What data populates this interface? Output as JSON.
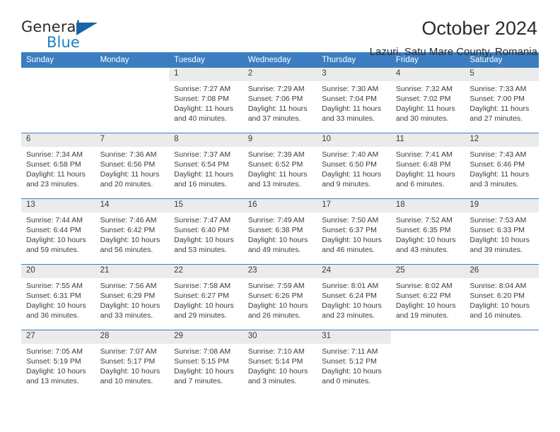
{
  "brand": {
    "name_top": "General",
    "name_bottom": "Blue",
    "accent_color": "#1f7fc4",
    "triangle_color": "#1565a8"
  },
  "header": {
    "title": "October 2024",
    "subtitle": "Lazuri, Satu Mare County, Romania"
  },
  "theme": {
    "header_row_bg": "#3b7dc0",
    "daynum_band_bg": "#ebebeb",
    "text_color": "#3b3b3b"
  },
  "weekday_headers": [
    "Sunday",
    "Monday",
    "Tuesday",
    "Wednesday",
    "Thursday",
    "Friday",
    "Saturday"
  ],
  "weeks": [
    [
      {
        "day": "",
        "lines": []
      },
      {
        "day": "",
        "lines": []
      },
      {
        "day": "1",
        "lines": [
          "Sunrise: 7:27 AM",
          "Sunset: 7:08 PM",
          "Daylight: 11 hours",
          "and 40 minutes."
        ]
      },
      {
        "day": "2",
        "lines": [
          "Sunrise: 7:29 AM",
          "Sunset: 7:06 PM",
          "Daylight: 11 hours",
          "and 37 minutes."
        ]
      },
      {
        "day": "3",
        "lines": [
          "Sunrise: 7:30 AM",
          "Sunset: 7:04 PM",
          "Daylight: 11 hours",
          "and 33 minutes."
        ]
      },
      {
        "day": "4",
        "lines": [
          "Sunrise: 7:32 AM",
          "Sunset: 7:02 PM",
          "Daylight: 11 hours",
          "and 30 minutes."
        ]
      },
      {
        "day": "5",
        "lines": [
          "Sunrise: 7:33 AM",
          "Sunset: 7:00 PM",
          "Daylight: 11 hours",
          "and 27 minutes."
        ]
      }
    ],
    [
      {
        "day": "6",
        "lines": [
          "Sunrise: 7:34 AM",
          "Sunset: 6:58 PM",
          "Daylight: 11 hours",
          "and 23 minutes."
        ]
      },
      {
        "day": "7",
        "lines": [
          "Sunrise: 7:36 AM",
          "Sunset: 6:56 PM",
          "Daylight: 11 hours",
          "and 20 minutes."
        ]
      },
      {
        "day": "8",
        "lines": [
          "Sunrise: 7:37 AM",
          "Sunset: 6:54 PM",
          "Daylight: 11 hours",
          "and 16 minutes."
        ]
      },
      {
        "day": "9",
        "lines": [
          "Sunrise: 7:39 AM",
          "Sunset: 6:52 PM",
          "Daylight: 11 hours",
          "and 13 minutes."
        ]
      },
      {
        "day": "10",
        "lines": [
          "Sunrise: 7:40 AM",
          "Sunset: 6:50 PM",
          "Daylight: 11 hours",
          "and 9 minutes."
        ]
      },
      {
        "day": "11",
        "lines": [
          "Sunrise: 7:41 AM",
          "Sunset: 6:48 PM",
          "Daylight: 11 hours",
          "and 6 minutes."
        ]
      },
      {
        "day": "12",
        "lines": [
          "Sunrise: 7:43 AM",
          "Sunset: 6:46 PM",
          "Daylight: 11 hours",
          "and 3 minutes."
        ]
      }
    ],
    [
      {
        "day": "13",
        "lines": [
          "Sunrise: 7:44 AM",
          "Sunset: 6:44 PM",
          "Daylight: 10 hours",
          "and 59 minutes."
        ]
      },
      {
        "day": "14",
        "lines": [
          "Sunrise: 7:46 AM",
          "Sunset: 6:42 PM",
          "Daylight: 10 hours",
          "and 56 minutes."
        ]
      },
      {
        "day": "15",
        "lines": [
          "Sunrise: 7:47 AM",
          "Sunset: 6:40 PM",
          "Daylight: 10 hours",
          "and 53 minutes."
        ]
      },
      {
        "day": "16",
        "lines": [
          "Sunrise: 7:49 AM",
          "Sunset: 6:38 PM",
          "Daylight: 10 hours",
          "and 49 minutes."
        ]
      },
      {
        "day": "17",
        "lines": [
          "Sunrise: 7:50 AM",
          "Sunset: 6:37 PM",
          "Daylight: 10 hours",
          "and 46 minutes."
        ]
      },
      {
        "day": "18",
        "lines": [
          "Sunrise: 7:52 AM",
          "Sunset: 6:35 PM",
          "Daylight: 10 hours",
          "and 43 minutes."
        ]
      },
      {
        "day": "19",
        "lines": [
          "Sunrise: 7:53 AM",
          "Sunset: 6:33 PM",
          "Daylight: 10 hours",
          "and 39 minutes."
        ]
      }
    ],
    [
      {
        "day": "20",
        "lines": [
          "Sunrise: 7:55 AM",
          "Sunset: 6:31 PM",
          "Daylight: 10 hours",
          "and 36 minutes."
        ]
      },
      {
        "day": "21",
        "lines": [
          "Sunrise: 7:56 AM",
          "Sunset: 6:29 PM",
          "Daylight: 10 hours",
          "and 33 minutes."
        ]
      },
      {
        "day": "22",
        "lines": [
          "Sunrise: 7:58 AM",
          "Sunset: 6:27 PM",
          "Daylight: 10 hours",
          "and 29 minutes."
        ]
      },
      {
        "day": "23",
        "lines": [
          "Sunrise: 7:59 AM",
          "Sunset: 6:26 PM",
          "Daylight: 10 hours",
          "and 26 minutes."
        ]
      },
      {
        "day": "24",
        "lines": [
          "Sunrise: 8:01 AM",
          "Sunset: 6:24 PM",
          "Daylight: 10 hours",
          "and 23 minutes."
        ]
      },
      {
        "day": "25",
        "lines": [
          "Sunrise: 8:02 AM",
          "Sunset: 6:22 PM",
          "Daylight: 10 hours",
          "and 19 minutes."
        ]
      },
      {
        "day": "26",
        "lines": [
          "Sunrise: 8:04 AM",
          "Sunset: 6:20 PM",
          "Daylight: 10 hours",
          "and 16 minutes."
        ]
      }
    ],
    [
      {
        "day": "27",
        "lines": [
          "Sunrise: 7:05 AM",
          "Sunset: 5:19 PM",
          "Daylight: 10 hours",
          "and 13 minutes."
        ]
      },
      {
        "day": "28",
        "lines": [
          "Sunrise: 7:07 AM",
          "Sunset: 5:17 PM",
          "Daylight: 10 hours",
          "and 10 minutes."
        ]
      },
      {
        "day": "29",
        "lines": [
          "Sunrise: 7:08 AM",
          "Sunset: 5:15 PM",
          "Daylight: 10 hours",
          "and 7 minutes."
        ]
      },
      {
        "day": "30",
        "lines": [
          "Sunrise: 7:10 AM",
          "Sunset: 5:14 PM",
          "Daylight: 10 hours",
          "and 3 minutes."
        ]
      },
      {
        "day": "31",
        "lines": [
          "Sunrise: 7:11 AM",
          "Sunset: 5:12 PM",
          "Daylight: 10 hours",
          "and 0 minutes."
        ]
      },
      {
        "day": "",
        "lines": []
      },
      {
        "day": "",
        "lines": []
      }
    ]
  ]
}
